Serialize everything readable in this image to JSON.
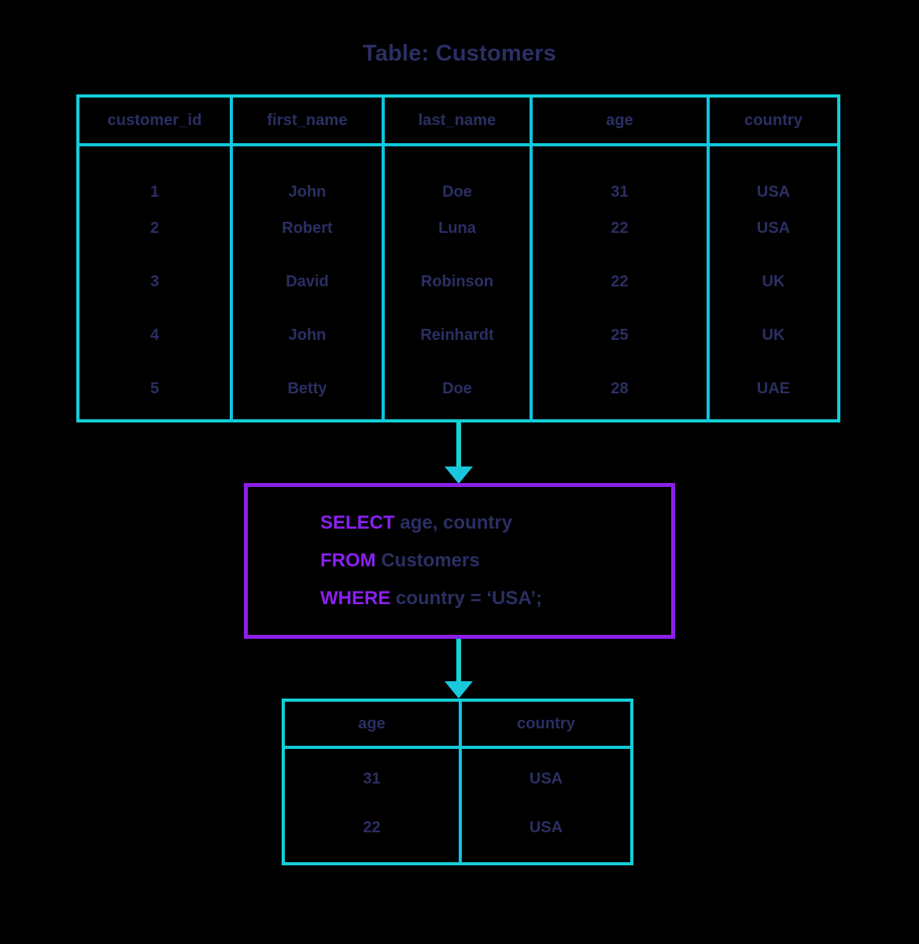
{
  "title": "Table: Customers",
  "colors": {
    "background": "#000000",
    "table_border": "#12cfd6",
    "query_border": "#8b20e8",
    "keyword": "#8b20ef",
    "text": "#2b2f63",
    "arrow": "#16d4d2"
  },
  "source_table": {
    "name": "Customers",
    "columns": [
      "customer_id",
      "first_name",
      "last_name",
      "age",
      "country"
    ],
    "rows": [
      [
        "1",
        "John",
        "Doe",
        "31",
        "USA"
      ],
      [
        "2",
        "Robert",
        "Luna",
        "22",
        "USA"
      ],
      [
        "3",
        "David",
        "Robinson",
        "22",
        "UK"
      ],
      [
        "4",
        "John",
        "Reinhardt",
        "25",
        "UK"
      ],
      [
        "5",
        "Betty",
        "Doe",
        "28",
        "UAE"
      ]
    ]
  },
  "query": {
    "lines": [
      {
        "keyword": "SELECT",
        "rest": " age, country"
      },
      {
        "keyword": "FROM",
        "rest": " Customers"
      },
      {
        "keyword": "WHERE",
        "rest": " country = ‘USA’;"
      }
    ]
  },
  "result_table": {
    "columns": [
      "age",
      "country"
    ],
    "rows": [
      [
        "31",
        "USA"
      ],
      [
        "22",
        "USA"
      ]
    ]
  },
  "arrows": [
    {
      "name": "arrow-table-to-query"
    },
    {
      "name": "arrow-query-to-result"
    }
  ]
}
